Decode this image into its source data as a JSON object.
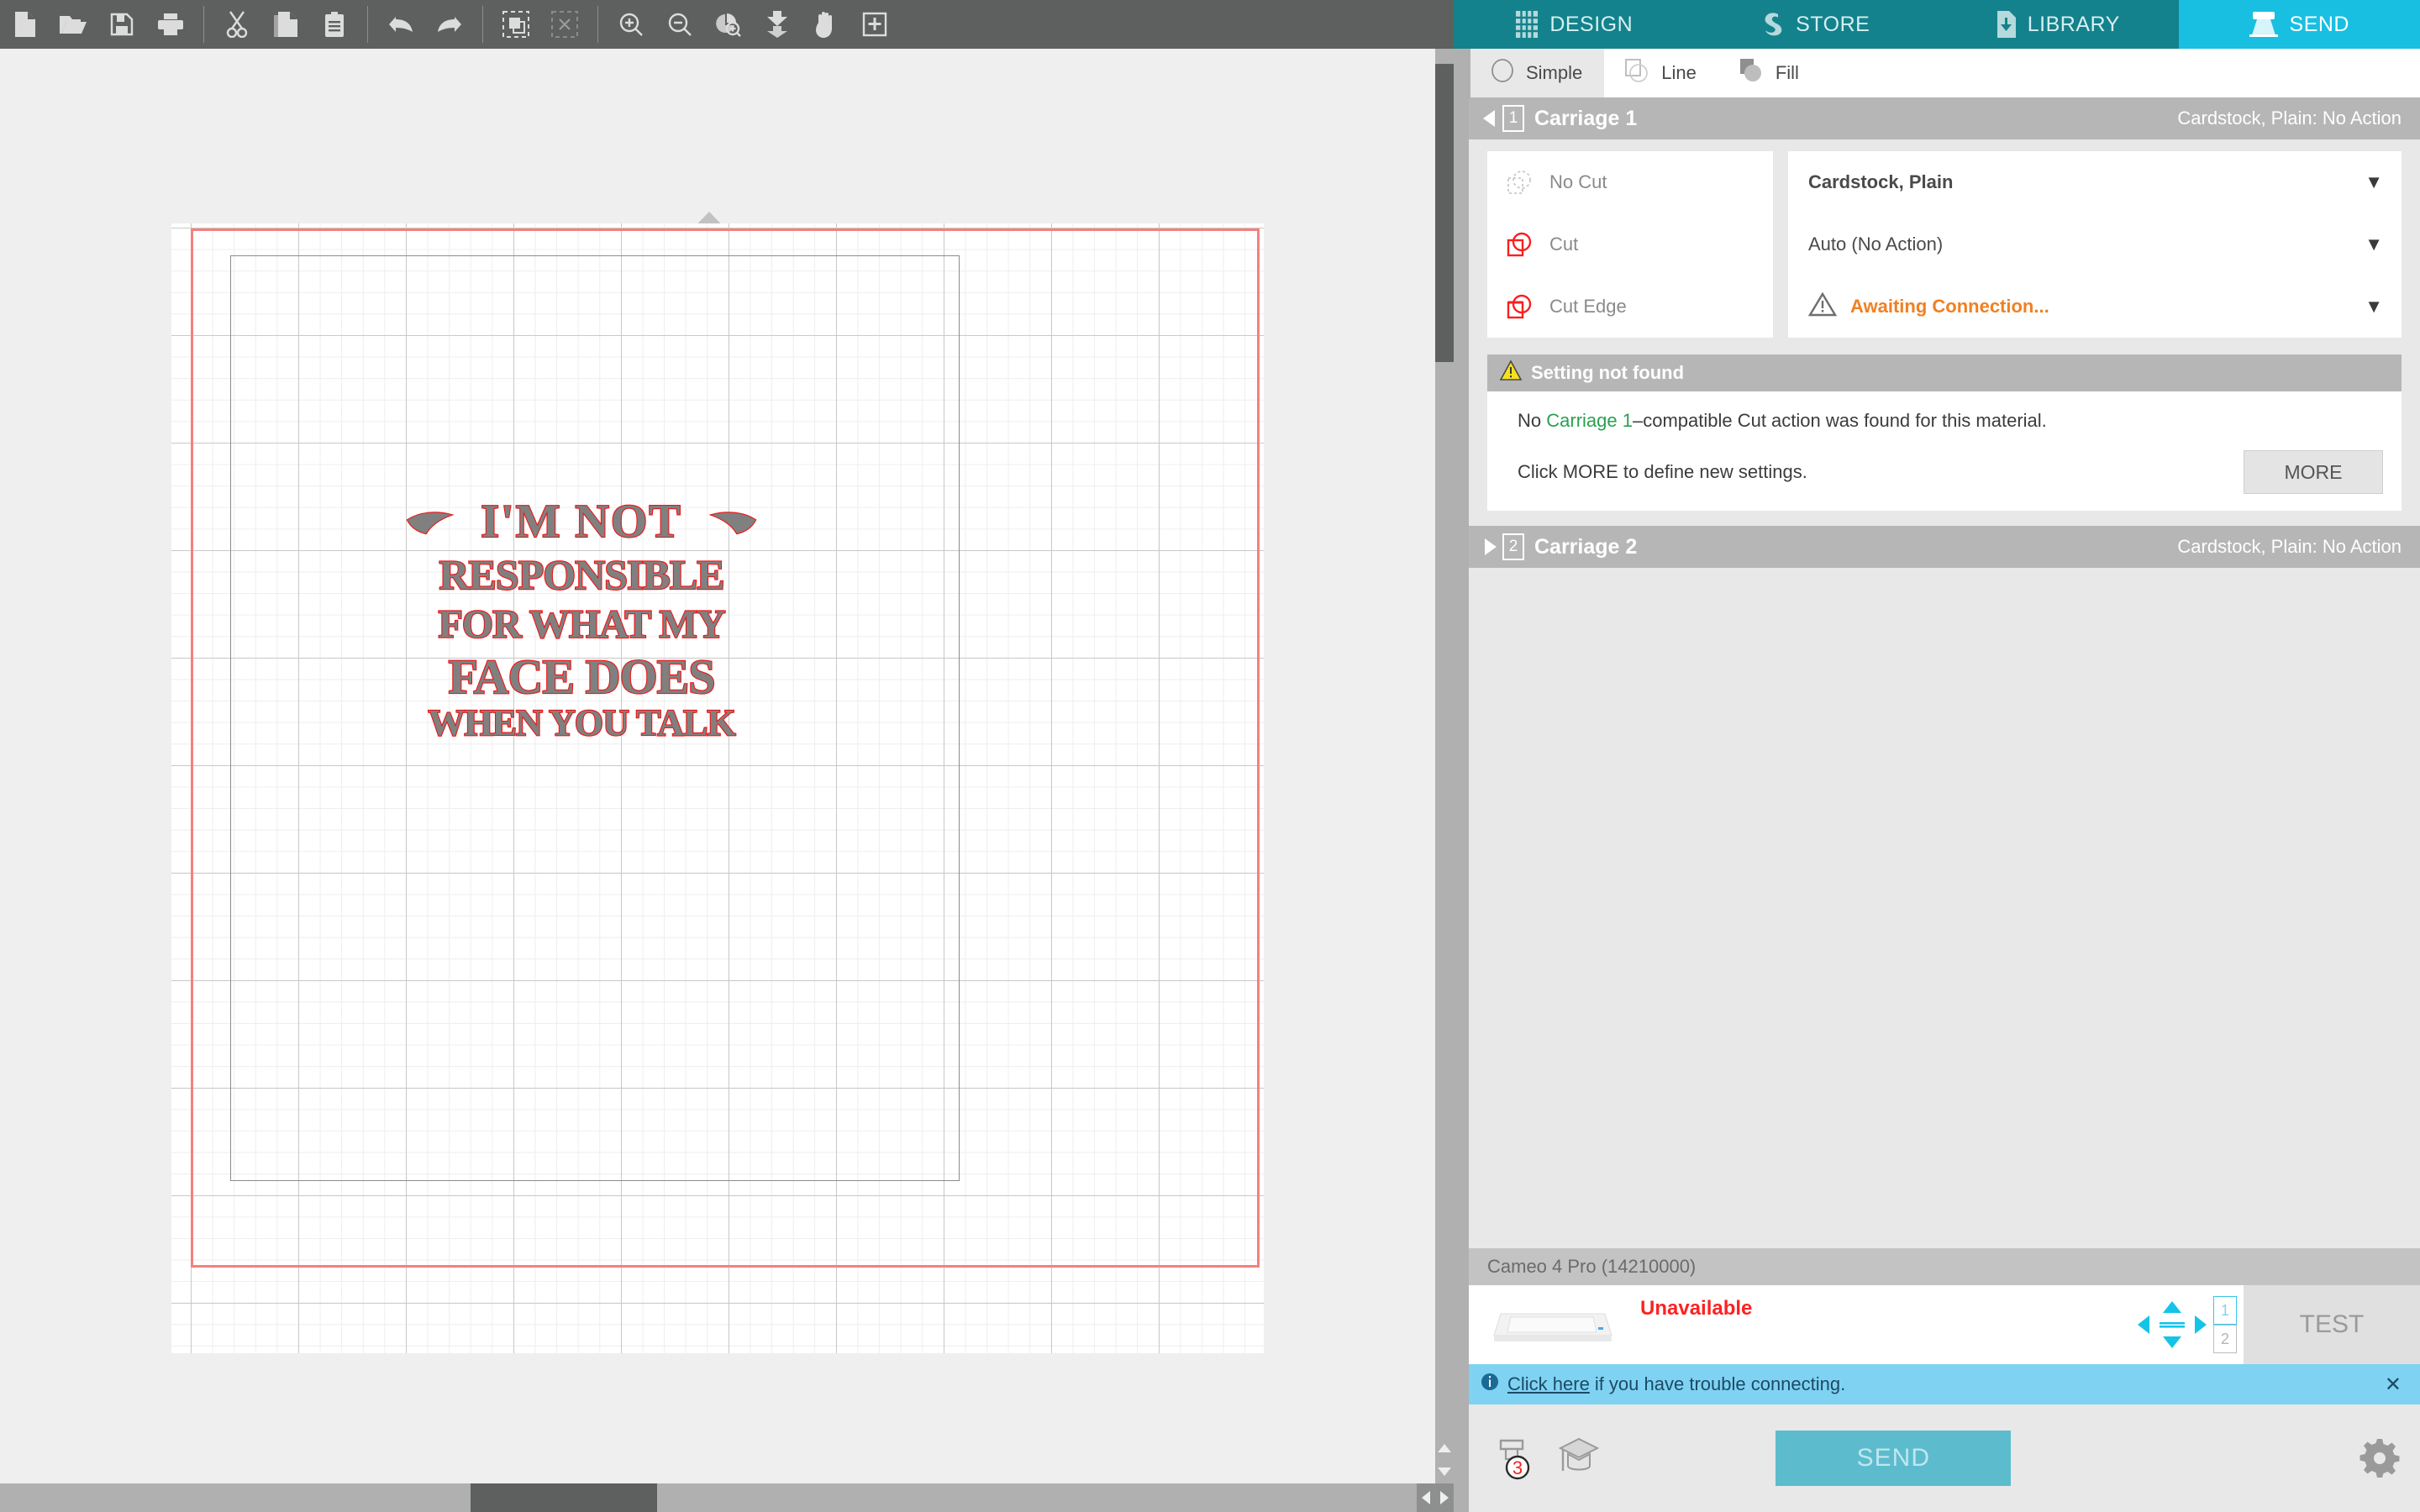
{
  "toolbar": {
    "groups": [
      {
        "items": [
          {
            "name": "new-document-icon",
            "label": "New"
          },
          {
            "name": "open-folder-icon",
            "label": "Open"
          },
          {
            "name": "save-icon",
            "label": "Save"
          },
          {
            "name": "print-icon",
            "label": "Print"
          }
        ]
      },
      {
        "items": [
          {
            "name": "cut-scissors-icon",
            "label": "Cut"
          },
          {
            "name": "copy-icon",
            "label": "Copy"
          },
          {
            "name": "paste-clipboard-icon",
            "label": "Paste"
          }
        ]
      },
      {
        "items": [
          {
            "name": "undo-icon",
            "label": "Undo"
          },
          {
            "name": "redo-icon",
            "label": "Redo"
          }
        ]
      },
      {
        "items": [
          {
            "name": "select-all-icon",
            "label": "Select All"
          },
          {
            "name": "deselect-all-icon",
            "label": "Deselect All"
          }
        ]
      },
      {
        "items": [
          {
            "name": "zoom-in-icon",
            "label": "Zoom In"
          },
          {
            "name": "zoom-out-icon",
            "label": "Zoom Out"
          },
          {
            "name": "zoom-selection-icon",
            "label": "Zoom to Selection"
          },
          {
            "name": "fit-to-window-icon",
            "label": "Fit To Window"
          },
          {
            "name": "pan-hand-icon",
            "label": "Pan"
          },
          {
            "name": "show-registration-icon",
            "label": "Registration Marks"
          }
        ]
      }
    ]
  },
  "canvas": {
    "mat_arrow_icon": "load-direction-arrow-icon",
    "design": {
      "name": "design-text-object",
      "lines": [
        "I'M NOT",
        "RESPONSIBLE",
        "FOR WHAT MY",
        "FACE DOES",
        "WHEN YOU TALK"
      ],
      "fill_color": "#808080",
      "outline_color": "#f01414"
    },
    "cut_border_color": "#f4817c",
    "page_border_color": "#8c8c8c"
  },
  "nav": {
    "tabs": [
      {
        "label": "DESIGN",
        "icon": "grid-icon",
        "active": false
      },
      {
        "label": "STORE",
        "icon": "store-swirl-icon",
        "active": false
      },
      {
        "label": "LIBRARY",
        "icon": "library-download-icon",
        "active": false
      },
      {
        "label": "SEND",
        "icon": "send-cutter-icon",
        "active": true
      }
    ],
    "active_color": "#19bfe0",
    "base_color": "#14828c"
  },
  "sub_tabs": [
    {
      "label": "Simple",
      "icon": "circle-outline-icon",
      "active": true
    },
    {
      "label": "Line",
      "icon": "line-shapes-icon",
      "active": false
    },
    {
      "label": "Fill",
      "icon": "fill-shapes-icon",
      "active": false
    }
  ],
  "carriage1": {
    "number": "1",
    "title": "Carriage 1",
    "status": "Cardstock, Plain: No Action",
    "expanded": true,
    "actions": [
      {
        "label": "No Cut",
        "icon": "no-cut-icon"
      },
      {
        "label": "Cut",
        "icon": "cut-icon"
      },
      {
        "label": "Cut Edge",
        "icon": "cut-edge-icon"
      }
    ],
    "material": {
      "label": "Cardstock, Plain",
      "caret": "▼"
    },
    "tool": {
      "label": "Auto (No Action)",
      "caret": "▼"
    },
    "connection": {
      "label": "Awaiting Connection...",
      "icon": "warning-triangle-icon",
      "caret": "▼",
      "color": "#f08022"
    },
    "warning": {
      "icon": "warning-triangle-yellow-icon",
      "title": "Setting not found",
      "line1_prefix": "No ",
      "line1_highlight": "Carriage 1",
      "line1_suffix": "–compatible Cut action was found for this material.",
      "line2": "Click MORE to define new settings.",
      "more_label": "MORE",
      "highlight_color": "#2aa050"
    }
  },
  "carriage2": {
    "number": "2",
    "title": "Carriage 2",
    "status": "Cardstock, Plain: No Action",
    "expanded": false
  },
  "device": {
    "name": "Cameo 4 Pro (14210000)",
    "thumb_icon": "cutter-machine-icon",
    "status": "Unavailable",
    "status_color": "#fc2222",
    "arrow_pad_icon": "arrow-pad-icon",
    "carriage_toggle": [
      {
        "label": "1",
        "selected": true
      },
      {
        "label": "2",
        "selected": false
      }
    ],
    "test_label": "TEST"
  },
  "help_bar": {
    "info_icon": "info-icon",
    "link_label": "Click here",
    "text": "if you have trouble connecting.",
    "close_label": "✕"
  },
  "action_bar": {
    "blade_icon": "blade-adjust-icon",
    "blade_badge": "3",
    "tutorial_icon": "graduation-cap-icon",
    "send_label": "SEND",
    "gear_icon": "gear-icon"
  },
  "scrollbars": {
    "vertical_up_icon": "scroll-up-icon",
    "vertical_down_icon": "scroll-down-icon",
    "horizontal_left_icon": "scroll-left-icon",
    "horizontal_right_icon": "scroll-right-icon"
  }
}
